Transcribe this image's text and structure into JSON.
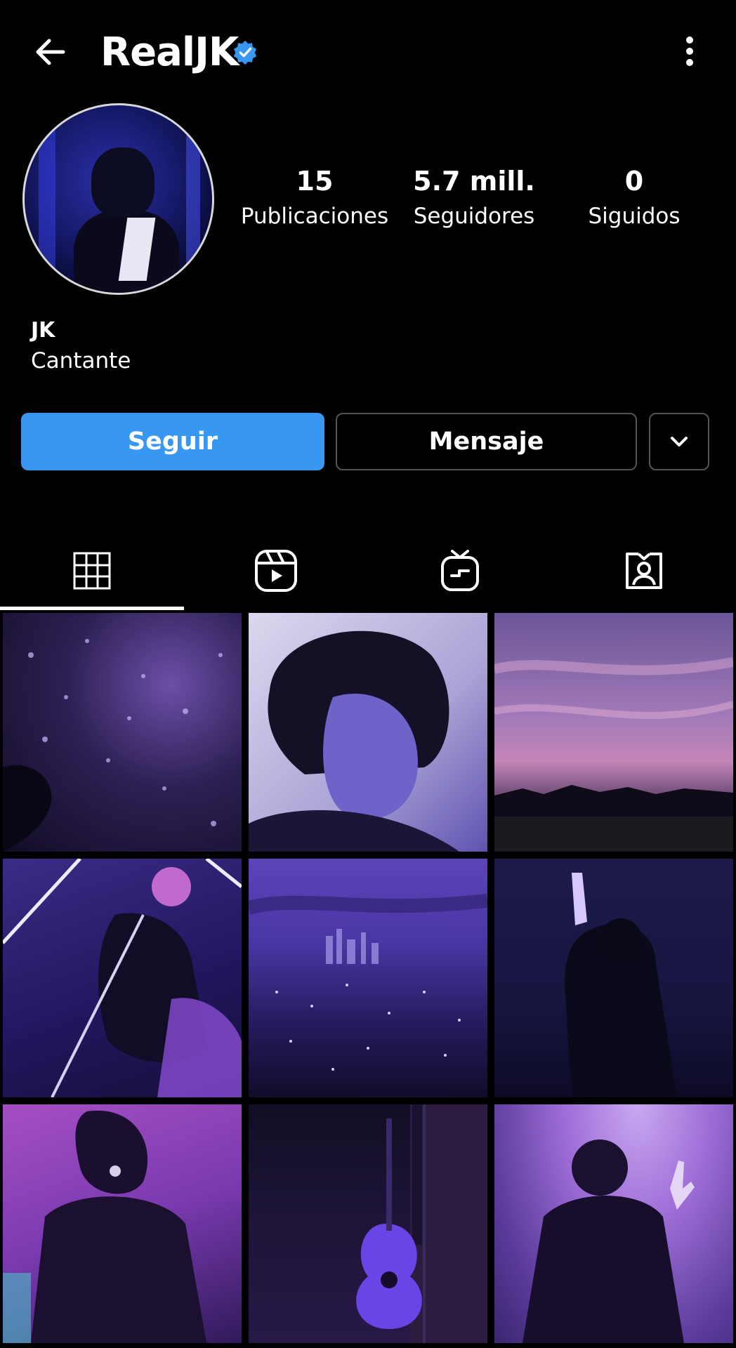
{
  "header": {
    "username": "RealJK",
    "back_icon": "arrow-left-icon",
    "verified_icon": "verified-badge-icon",
    "menu_icon": "more-vertical-icon",
    "verified_color": "#3897f0"
  },
  "stats": [
    {
      "value": "15",
      "label": "Publicaciones"
    },
    {
      "value": "5.7 mill.",
      "label": "Seguidores"
    },
    {
      "value": "0",
      "label": "Siguidos"
    }
  ],
  "bio": {
    "name": "JK",
    "category": "Cantante"
  },
  "actions": {
    "follow_label": "Seguir",
    "message_label": "Mensaje",
    "more_icon": "chevron-down-icon",
    "follow_color": "#3897f0"
  },
  "tabs": [
    {
      "icon": "grid-icon",
      "active": true
    },
    {
      "icon": "reels-icon",
      "active": false
    },
    {
      "icon": "igtv-icon",
      "active": false
    },
    {
      "icon": "tagged-icon",
      "active": false
    }
  ],
  "posts": [
    "concert-crowd-purple-lights",
    "portrait-dark-hair-earpiece",
    "purple-sunset-sky",
    "singer-pink-hair-microphone",
    "purple-city-skyline-night",
    "performer-raised-hand",
    "singer-with-microphone-purple",
    "acoustic-guitar-purple",
    "performer-hand-sign-stage"
  ]
}
